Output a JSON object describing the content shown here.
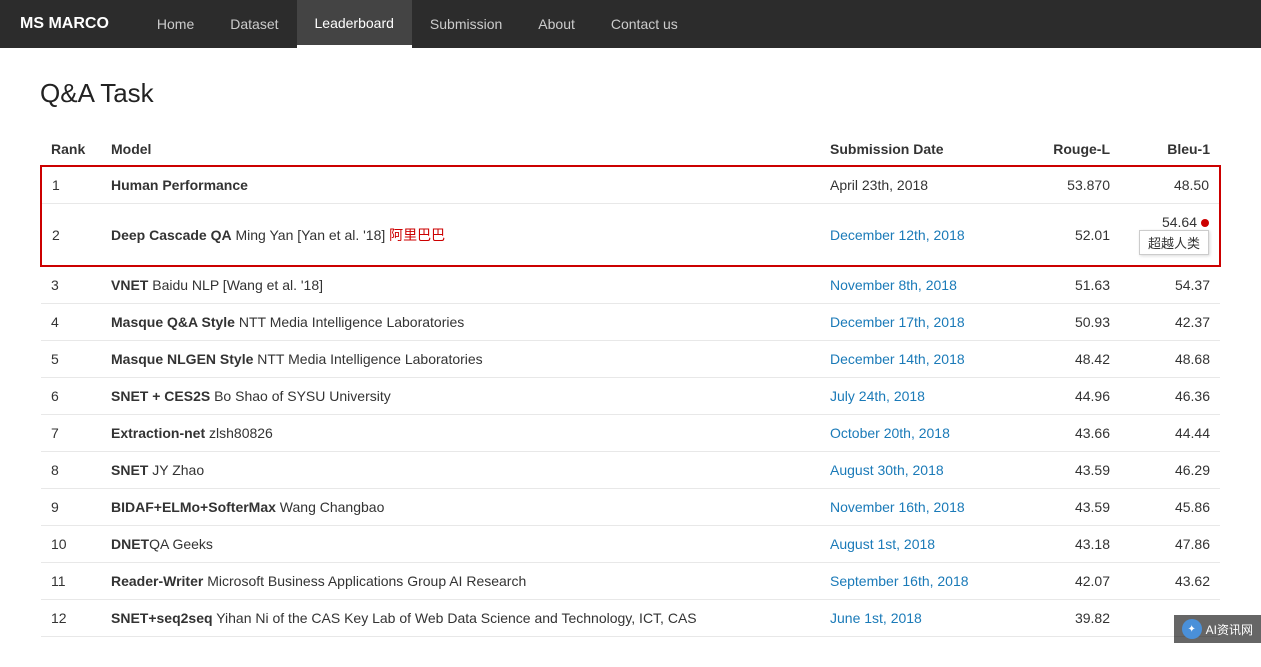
{
  "nav": {
    "brand": "MS MARCO",
    "items": [
      {
        "label": "Home",
        "active": false
      },
      {
        "label": "Dataset",
        "active": false
      },
      {
        "label": "Leaderboard",
        "active": true
      },
      {
        "label": "Submission",
        "active": false
      },
      {
        "label": "About",
        "active": false
      },
      {
        "label": "Contact us",
        "active": false
      }
    ]
  },
  "page": {
    "title": "Q&A Task"
  },
  "table": {
    "headers": [
      "Rank",
      "Model",
      "Submission Date",
      "Rouge-L",
      "Bleu-1"
    ],
    "rows": [
      {
        "rank": "1",
        "model_bold": "Human Performance",
        "model_rest": "",
        "date": "April 23th, 2018",
        "date_link": false,
        "rouge": "53.870",
        "bleu": "48.50",
        "highlight": true,
        "has_dot": false,
        "has_badge": false,
        "has_chinese": false
      },
      {
        "rank": "2",
        "model_bold": "Deep Cascade QA",
        "model_rest": " Ming Yan [Yan et al. '18]",
        "model_chinese": "  阿里巴巴",
        "date": "December 12th, 2018",
        "date_link": true,
        "rouge": "52.01",
        "bleu": "54.64",
        "highlight": true,
        "has_dot": true,
        "has_badge": true,
        "badge_text": "超越人类"
      },
      {
        "rank": "3",
        "model_bold": "VNET",
        "model_rest": " Baidu NLP [Wang et al. '18]",
        "date": "November 8th, 2018",
        "date_link": true,
        "rouge": "51.63",
        "bleu": "54.37",
        "highlight": false,
        "has_dot": false,
        "has_badge": false
      },
      {
        "rank": "4",
        "model_bold": "Masque Q&A Style",
        "model_rest": " NTT Media Intelligence Laboratories",
        "date": "December 17th, 2018",
        "date_link": true,
        "rouge": "50.93",
        "bleu": "42.37",
        "highlight": false,
        "has_dot": false,
        "has_badge": false
      },
      {
        "rank": "5",
        "model_bold": "Masque NLGEN Style",
        "model_rest": " NTT Media Intelligence Laboratories",
        "date": "December 14th, 2018",
        "date_link": true,
        "rouge": "48.42",
        "bleu": "48.68",
        "highlight": false,
        "has_dot": false,
        "has_badge": false
      },
      {
        "rank": "6",
        "model_bold": "SNET + CES2S",
        "model_rest": " Bo Shao of SYSU University",
        "date": "July 24th, 2018",
        "date_link": true,
        "rouge": "44.96",
        "bleu": "46.36",
        "highlight": false,
        "has_dot": false,
        "has_badge": false
      },
      {
        "rank": "7",
        "model_bold": "Extraction-net",
        "model_rest": " zlsh80826",
        "date": "October 20th, 2018",
        "date_link": true,
        "rouge": "43.66",
        "bleu": "44.44",
        "highlight": false,
        "has_dot": false,
        "has_badge": false
      },
      {
        "rank": "8",
        "model_bold": "SNET",
        "model_rest": " JY Zhao",
        "date": "August 30th, 2018",
        "date_link": true,
        "rouge": "43.59",
        "bleu": "46.29",
        "highlight": false,
        "has_dot": false,
        "has_badge": false
      },
      {
        "rank": "9",
        "model_bold": "BIDAF+ELMo+SofterMax",
        "model_rest": " Wang Changbao",
        "date": "November 16th, 2018",
        "date_link": true,
        "rouge": "43.59",
        "bleu": "45.86",
        "highlight": false,
        "has_dot": false,
        "has_badge": false
      },
      {
        "rank": "10",
        "model_bold": "DNET",
        "model_rest": "QA Geeks",
        "date": "August 1st, 2018",
        "date_link": true,
        "rouge": "43.18",
        "bleu": "47.86",
        "highlight": false,
        "has_dot": false,
        "has_badge": false
      },
      {
        "rank": "11",
        "model_bold": "Reader-Writer",
        "model_rest": " Microsoft Business Applications Group AI Research",
        "date": "September 16th, 2018",
        "date_link": true,
        "rouge": "42.07",
        "bleu": "43.62",
        "highlight": false,
        "has_dot": false,
        "has_badge": false
      },
      {
        "rank": "12",
        "model_bold": "SNET+seq2seq",
        "model_rest": " Yihan Ni of the CAS Key Lab of Web Data Science and Technology, ICT, CAS",
        "date": "June 1st, 2018",
        "date_link": true,
        "rouge": "39.82",
        "bleu": "",
        "highlight": false,
        "has_dot": false,
        "has_badge": false
      }
    ]
  },
  "watermark": "AI资讯网"
}
